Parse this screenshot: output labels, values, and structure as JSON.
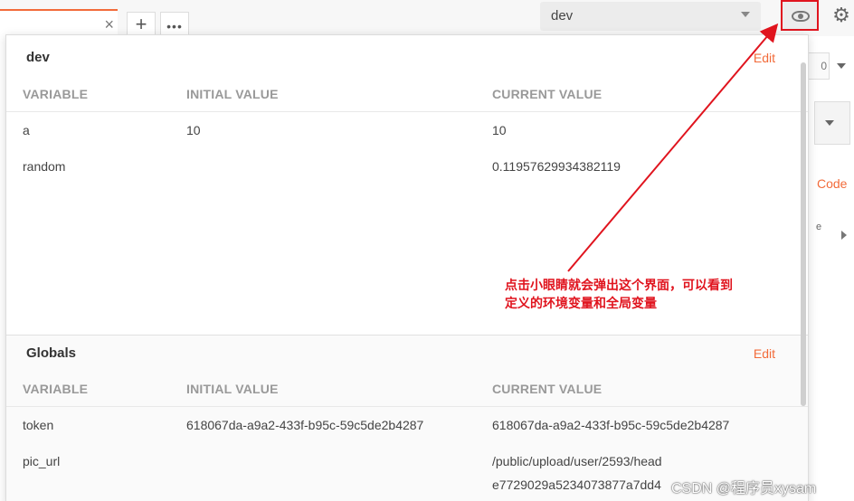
{
  "tabs": {
    "close_glyph": "×",
    "add_glyph": "+",
    "more_glyph": "•••"
  },
  "environment": {
    "selected": "dev",
    "gear_glyph": "⚙"
  },
  "background": {
    "field_text": "0",
    "code_link": "Code",
    "e_text": "e"
  },
  "env_section": {
    "title": "dev",
    "edit_label": "Edit",
    "columns": [
      "VARIABLE",
      "INITIAL VALUE",
      "CURRENT VALUE"
    ],
    "rows": [
      {
        "variable": "a",
        "initial": "10",
        "current": "10"
      },
      {
        "variable": "random",
        "initial": "",
        "current": "0.11957629934382119"
      }
    ]
  },
  "globals_section": {
    "title": "Globals",
    "edit_label": "Edit",
    "columns": [
      "VARIABLE",
      "INITIAL VALUE",
      "CURRENT VALUE"
    ],
    "rows": [
      {
        "variable": "token",
        "initial": "618067da-a9a2-433f-b95c-59c5de2b4287",
        "current": "618067da-a9a2-433f-b95c-59c5de2b4287"
      },
      {
        "variable": "pic_url",
        "initial": "",
        "current": "/public/upload/user/2593/head",
        "current_line2": "e7729029a5234073877a7dd4"
      }
    ]
  },
  "annotation": {
    "line1": "点击小眼睛就会弹出这个界面，可以看到",
    "line2": "定义的环境变量和全局变量",
    "color": "#e0141e"
  },
  "watermark": "CSDN @程序员xysam",
  "colors": {
    "accent": "#f26b3a",
    "highlight": "#e0141e"
  }
}
